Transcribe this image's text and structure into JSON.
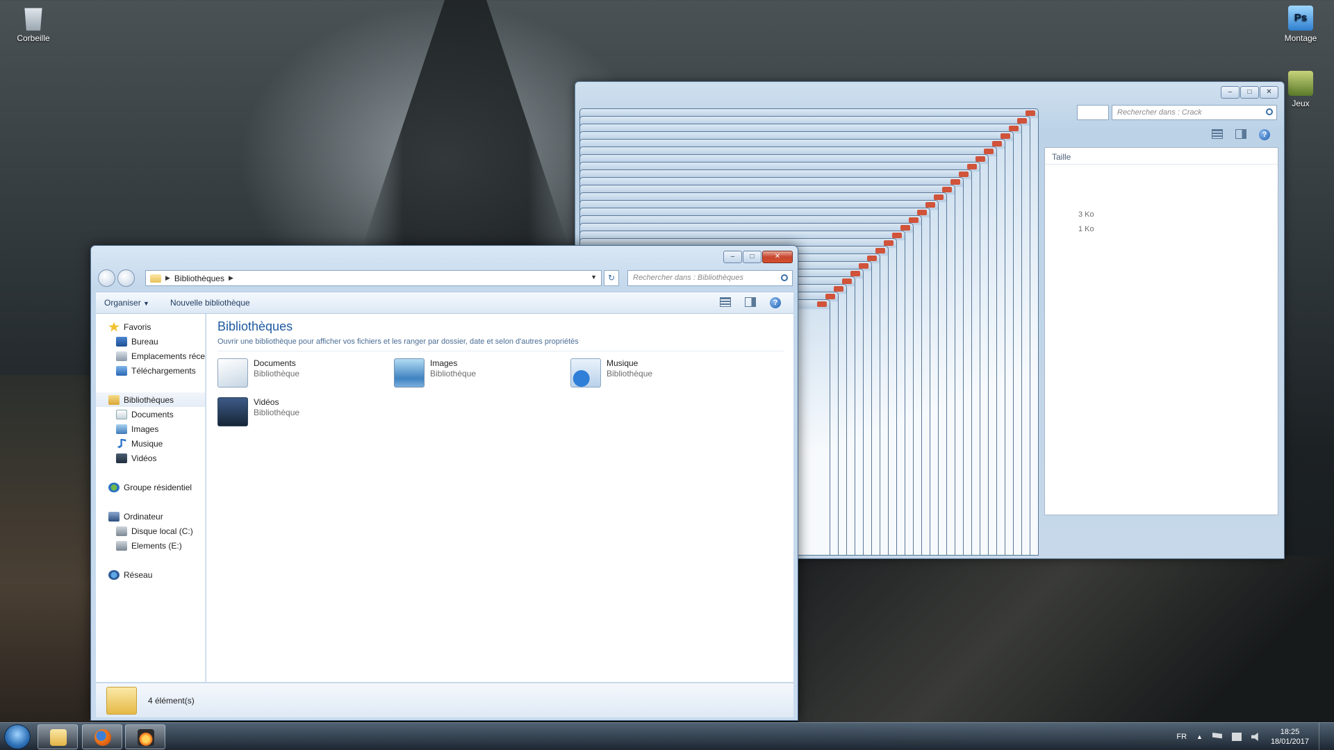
{
  "desktop": {
    "icons": {
      "recycle": "Corbeille",
      "montage": "Montage",
      "jeux": "Jeux"
    }
  },
  "back_window": {
    "search_placeholder": "Rechercher dans : Crack",
    "column_size": "Taille",
    "rows": [
      {
        "size": "3 Ko"
      },
      {
        "size": "1 Ko"
      }
    ]
  },
  "main_window": {
    "breadcrumb": "Bibliothèques",
    "search_placeholder": "Rechercher dans : Bibliothèques",
    "toolbar": {
      "organize": "Organiser",
      "new_library": "Nouvelle bibliothèque"
    },
    "nav": {
      "favorites": "Favoris",
      "desktop": "Bureau",
      "recent": "Emplacements récents",
      "downloads": "Téléchargements",
      "libraries": "Bibliothèques",
      "documents": "Documents",
      "images": "Images",
      "music": "Musique",
      "videos": "Vidéos",
      "homegroup": "Groupe résidentiel",
      "computer": "Ordinateur",
      "local_disk": "Disque local (C:)",
      "elements": "Elements (E:)",
      "network": "Réseau"
    },
    "content": {
      "title": "Bibliothèques",
      "description": "Ouvrir une bibliothèque pour afficher vos fichiers et les ranger par dossier, date et selon d'autres propriétés",
      "libraries": [
        {
          "name": "Documents",
          "type": "Bibliothèque",
          "icon": "documents-library-icon"
        },
        {
          "name": "Images",
          "type": "Bibliothèque",
          "icon": "images-library-icon"
        },
        {
          "name": "Musique",
          "type": "Bibliothèque",
          "icon": "music-library-icon"
        },
        {
          "name": "Vidéos",
          "type": "Bibliothèque",
          "icon": "videos-library-icon"
        }
      ]
    },
    "details": {
      "count": "4 élément(s)"
    }
  },
  "taskbar": {
    "language": "FR",
    "time": "18:25",
    "date": "18/01/2017"
  }
}
